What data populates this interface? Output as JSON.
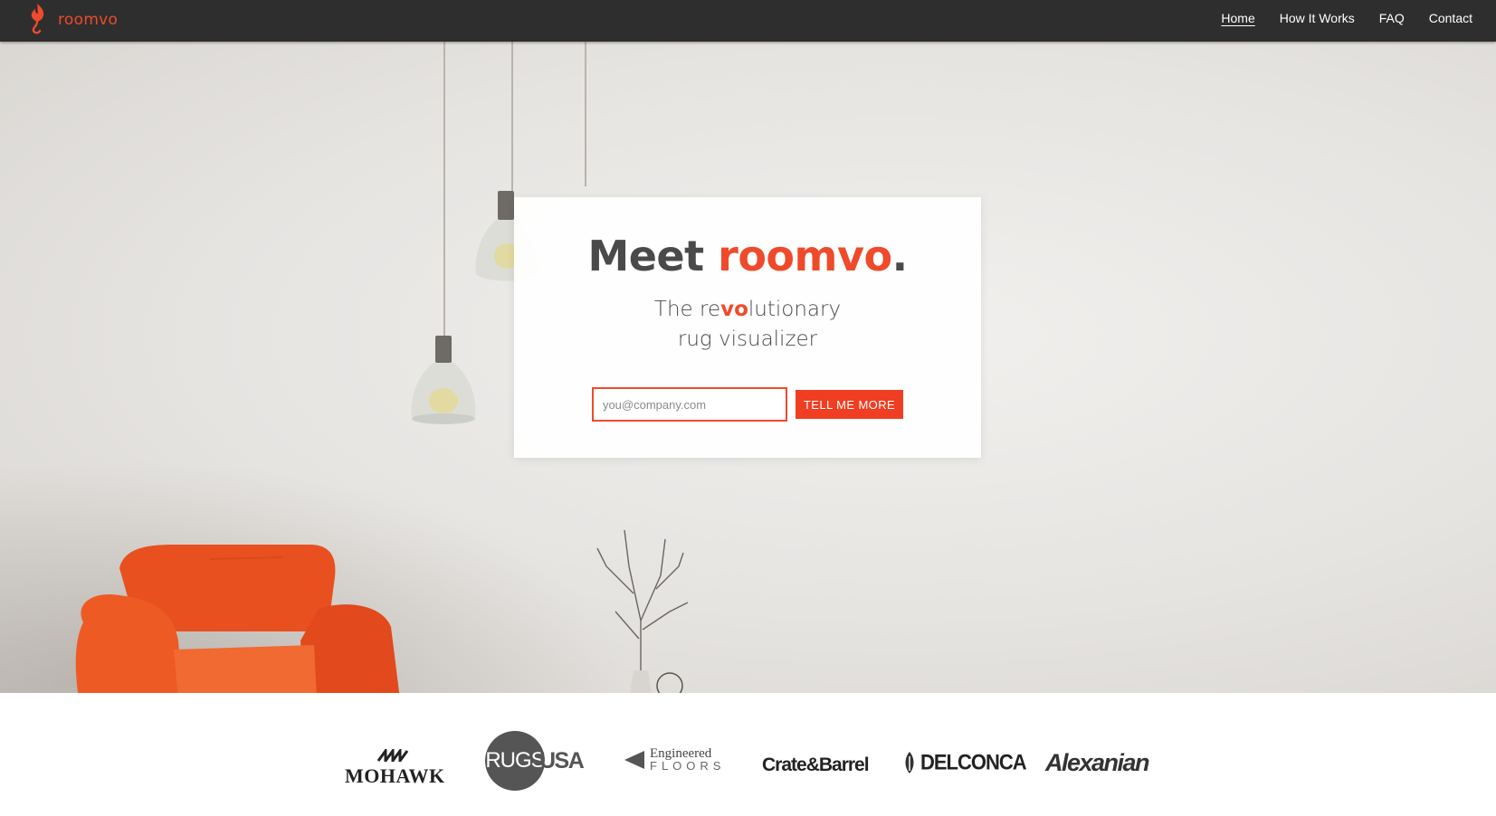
{
  "brand": {
    "name": "roomvo",
    "color": "#ef4a2b",
    "icon": "flame-logo-icon"
  },
  "nav": {
    "items": [
      {
        "label": "Home",
        "active": true
      },
      {
        "label": "How It Works",
        "active": false
      },
      {
        "label": "FAQ",
        "active": false
      },
      {
        "label": "Contact",
        "active": false
      }
    ]
  },
  "hero": {
    "headline_prefix": "Meet ",
    "headline_brand": "roomvo",
    "headline_suffix": ".",
    "tagline_part1": "The re",
    "tagline_highlight": "vo",
    "tagline_part2": "lutionary",
    "tagline_line2": "rug visualizer",
    "email_placeholder": "you@company.com",
    "email_value": "",
    "cta_label": "TELL ME MORE"
  },
  "partners": {
    "mohawk": "MOHAWK",
    "rugsusa_a": "RUGS",
    "rugsusa_b": "USA",
    "engineered_a": "Engineered",
    "engineered_b": "FLOORS",
    "crate": "Crate&Barrel",
    "delconca": "DELCONCA",
    "alexanian": "Alexanian"
  },
  "colors": {
    "accent": "#ef4a2b",
    "navbar": "#2e2e2e",
    "chair": "#e8501f"
  }
}
